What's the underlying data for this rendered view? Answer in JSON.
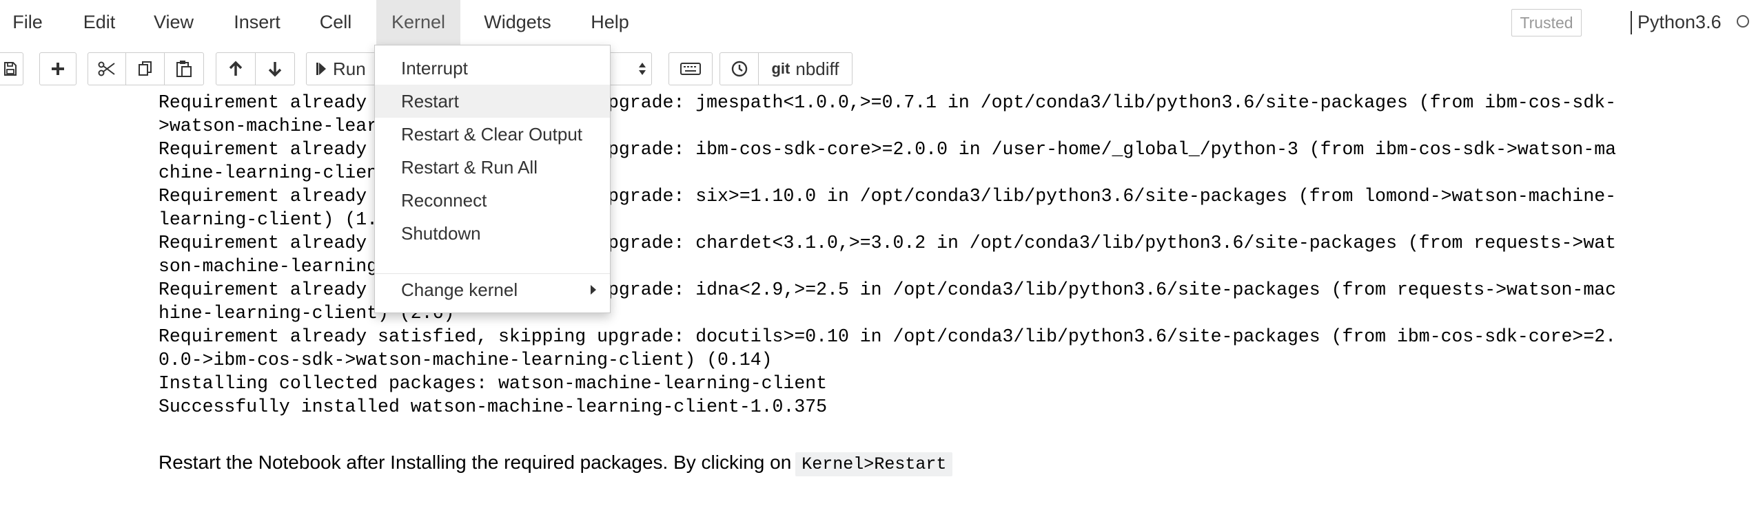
{
  "menubar": {
    "items": [
      "File",
      "Edit",
      "View",
      "Insert",
      "Cell",
      "Kernel",
      "Widgets",
      "Help"
    ],
    "active": "Kernel",
    "trusted_label": "Trusted",
    "kernel_name": "Python3.6"
  },
  "toolbar": {
    "run_label": "Run",
    "nbdiff_label": "nbdiff",
    "git_label": "git",
    "icons": [
      "save-icon",
      "plus-icon",
      "cut-icon",
      "copy-icon",
      "paste-icon",
      "arrow-up-icon",
      "arrow-down-icon",
      "run-icon",
      "keyboard-icon",
      "clock-icon"
    ]
  },
  "kernel_menu": {
    "items": [
      "Interrupt",
      "Restart",
      "Restart & Clear Output",
      "Restart & Run All",
      "Reconnect",
      "Shutdown",
      "Change kernel"
    ],
    "highlighted": "Restart"
  },
  "output": {
    "lines": [
      "Requirement already satisfied, skipping upgrade: jmespath<1.0.0,>=0.7.1 in /opt/conda3/lib/python3.6/site-packages (from ibm-cos-sdk-",
      ">watson-machine-learning-client) (0.9.3)",
      "Requirement already satisfied, skipping upgrade: ibm-cos-sdk-core>=2.0.0 in /user-home/_global_/python-3 (from ibm-cos-sdk->watson-ma",
      "chine-learning-client) (2.4.4)",
      "Requirement already satisfied, skipping upgrade: six>=1.10.0 in /opt/conda3/lib/python3.6/site-packages (from lomond->watson-machine-",
      "learning-client) (1.11.0)",
      "Requirement already satisfied, skipping upgrade: chardet<3.1.0,>=3.0.2 in /opt/conda3/lib/python3.6/site-packages (from requests->wat",
      "son-machine-learning-client) (3.0.4)",
      "Requirement already satisfied, skipping upgrade: idna<2.9,>=2.5 in /opt/conda3/lib/python3.6/site-packages (from requests->watson-mac",
      "hine-learning-client) (2.6)",
      "Requirement already satisfied, skipping upgrade: docutils>=0.10 in /opt/conda3/lib/python3.6/site-packages (from ibm-cos-sdk-core>=2.",
      "0.0->ibm-cos-sdk->watson-machine-learning-client) (0.14)",
      "Installing collected packages: watson-machine-learning-client",
      "Successfully installed watson-machine-learning-client-1.0.375"
    ]
  },
  "markdown": {
    "text": "Restart the Notebook after Installing the required packages. By clicking on",
    "code": "Kernel>Restart"
  }
}
